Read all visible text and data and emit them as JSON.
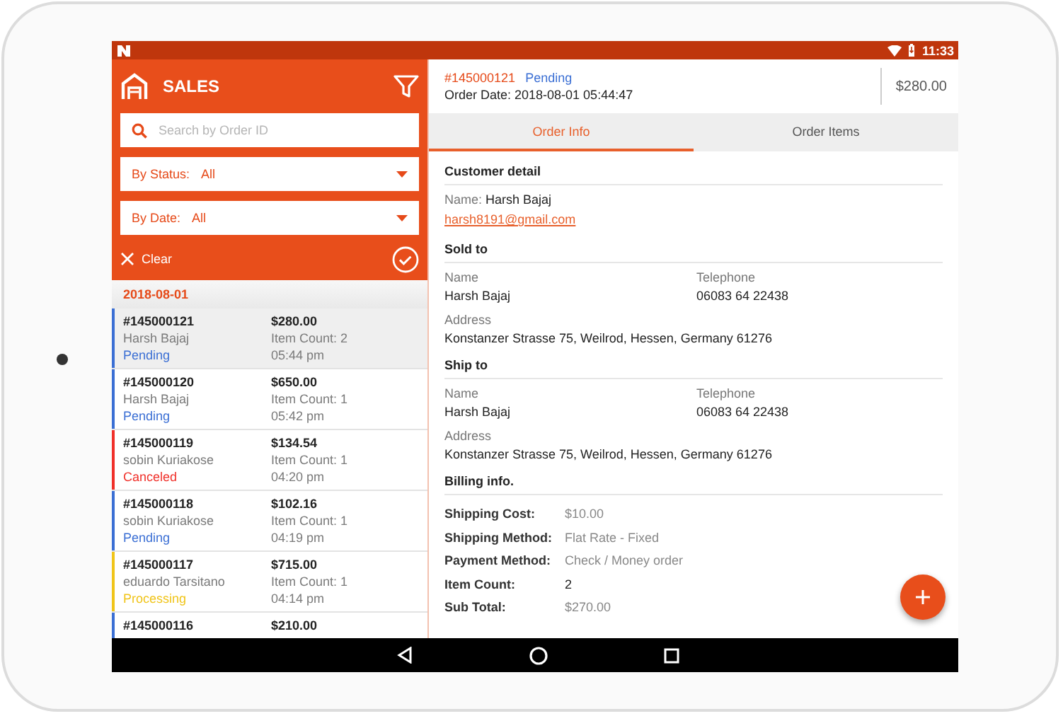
{
  "status_bar": {
    "time": "11:33"
  },
  "sidebar": {
    "title": "SALES",
    "search": {
      "placeholder": "Search by Order ID"
    },
    "filters": [
      {
        "label": "By Status:",
        "value": "All"
      },
      {
        "label": "By Date:",
        "value": "All"
      }
    ],
    "clear": "Clear",
    "date_header": "2018-08-01",
    "orders": [
      {
        "id": "#145000121",
        "customer": "Harsh Bajaj",
        "status": "Pending",
        "color": "#3b6fd4",
        "total": "$280.00",
        "item_count": "Item Count: 2",
        "time": "05:44 pm",
        "selected": true
      },
      {
        "id": "#145000120",
        "customer": "Harsh Bajaj",
        "status": "Pending",
        "color": "#3b6fd4",
        "total": "$650.00",
        "item_count": "Item Count: 1",
        "time": "05:42 pm",
        "selected": false
      },
      {
        "id": "#145000119",
        "customer": "sobin Kuriakose",
        "status": "Canceled",
        "color": "#f0302a",
        "total": "$134.54",
        "item_count": "Item Count: 1",
        "time": "04:20 pm",
        "selected": false
      },
      {
        "id": "#145000118",
        "customer": "sobin Kuriakose",
        "status": "Pending",
        "color": "#3b6fd4",
        "total": "$102.16",
        "item_count": "Item Count: 1",
        "time": "04:19 pm",
        "selected": false
      },
      {
        "id": "#145000117",
        "customer": "eduardo Tarsitano",
        "status": "Processing",
        "color": "#f0c419",
        "total": "$715.00",
        "item_count": "Item Count: 1",
        "time": "04:14 pm",
        "selected": false
      },
      {
        "id": "#145000116",
        "color": "#3b6fd4",
        "total": "$210.00",
        "selected": false
      }
    ]
  },
  "detail": {
    "order_id": "#145000121",
    "status": "Pending",
    "order_date": "Order Date: 2018-08-01 05:44:47",
    "total": "$280.00",
    "tabs": [
      {
        "label": "Order Info",
        "selected": true
      },
      {
        "label": "Order Items",
        "selected": false
      }
    ],
    "customer": {
      "title": "Customer detail",
      "name_label": "Name:",
      "name": "Harsh Bajaj",
      "email": "harsh8191@gmail.com"
    },
    "addresses": [
      {
        "title": "Sold to",
        "name_label": "Name",
        "name": "Harsh Bajaj",
        "phone_label": "Telephone",
        "phone": "06083 64 22438",
        "address_label": "Address",
        "address": "Konstanzer Strasse 75, Weilrod, Hessen, Germany 61276"
      },
      {
        "title": "Ship to",
        "name_label": "Name",
        "name": "Harsh Bajaj",
        "phone_label": "Telephone",
        "phone": "06083 64 22438",
        "address_label": "Address",
        "address": "Konstanzer Strasse 75, Weilrod, Hessen, Germany 61276"
      }
    ],
    "billing": {
      "title": "Billing info.",
      "rows": [
        {
          "label": "Shipping Cost:",
          "value": "$10.00",
          "kind": "muted"
        },
        {
          "label": "Shipping Method:",
          "value": "Flat Rate - Fixed",
          "kind": "muted"
        },
        {
          "label": "Payment Method:",
          "value": "Check / Money order",
          "kind": "muted"
        },
        {
          "label": "Item Count:",
          "value": "2",
          "kind": "plain"
        },
        {
          "label": "Sub Total:",
          "value": "$270.00",
          "kind": "muted"
        }
      ]
    }
  }
}
